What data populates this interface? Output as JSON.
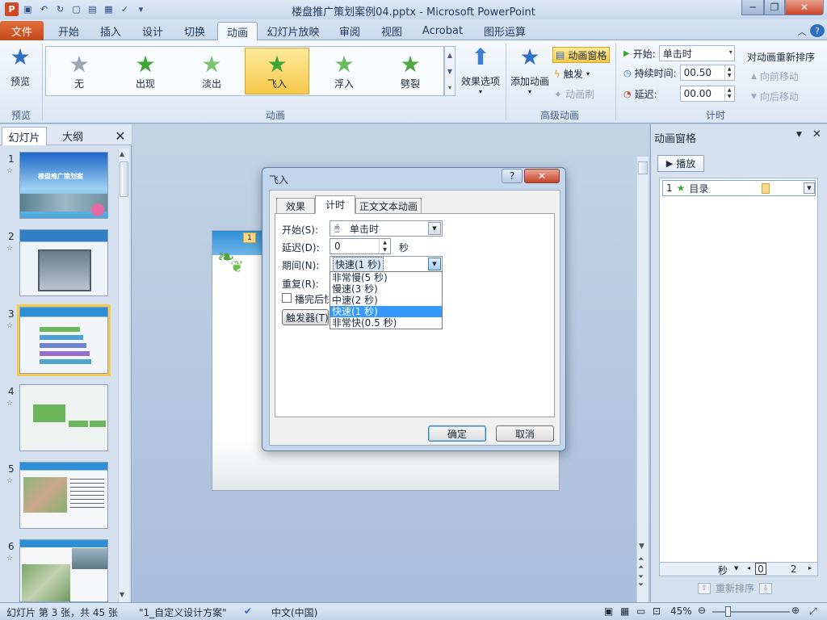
{
  "window": {
    "title": "楼盘推广策划案例04.pptx - Microsoft PowerPoint",
    "min": "─",
    "max": "❐",
    "close": "✕"
  },
  "tabs": [
    "开始",
    "插入",
    "设计",
    "切换",
    "动画",
    "幻灯片放映",
    "审阅",
    "视图",
    "Acrobat",
    "图形运算"
  ],
  "file_tab": "文件",
  "active_tab": "动画",
  "ribbon": {
    "preview": {
      "label": "预览",
      "group": "预览"
    },
    "gallery": {
      "items": [
        "无",
        "出现",
        "淡出",
        "飞入",
        "浮入",
        "劈裂"
      ],
      "selected": "飞入",
      "group": "动画"
    },
    "effect_options": "效果选项",
    "add_animation": "添加动画",
    "anim_pane": "动画窗格",
    "trigger": "触发",
    "anim_painter": "动画刷",
    "advanced_group": "高级动画",
    "start_label": "开始:",
    "start_value": "单击时",
    "duration_label": "持续时间:",
    "duration_value": "00.50",
    "delay_label": "延迟:",
    "delay_value": "00.00",
    "timing_group": "计时",
    "reorder_title": "对动画重新排序",
    "move_earlier": "向前移动",
    "move_later": "向后移动"
  },
  "left_pane": {
    "tab_slides": "幻灯片",
    "tab_outline": "大纲",
    "close": "✕",
    "slides": [
      {
        "num": "1",
        "caption": "楼盘推广策划案"
      },
      {
        "num": "2",
        "caption": ""
      },
      {
        "num": "3",
        "caption": ""
      },
      {
        "num": "4",
        "caption": ""
      },
      {
        "num": "5",
        "caption": ""
      },
      {
        "num": "6",
        "caption": ""
      }
    ],
    "current": "3"
  },
  "slide": {
    "tag": "1"
  },
  "anim_pane": {
    "title": "动画窗格",
    "play": "播放",
    "item_num": "1",
    "item_name": "目录",
    "seconds": "秒",
    "tick0": "0",
    "tick2": "2",
    "reorder": "重新排序"
  },
  "dialog": {
    "title": "飞入",
    "help": "?",
    "close": "✕",
    "tabs": [
      "效果",
      "计时",
      "正文文本动画"
    ],
    "active_tab": "计时",
    "start_label": "开始(S):",
    "start_value": "单击时",
    "delay_label": "延迟(D):",
    "delay_value": "0",
    "delay_unit": "秒",
    "period_label": "期间(N):",
    "period_value": "快速(1 秒)",
    "repeat_label": "重复(R):",
    "rewind_label": "播完后快退(W)",
    "trigger_btn": "触发器(T)",
    "options": [
      "非常慢(5 秒)",
      "慢速(3 秒)",
      "中速(2 秒)",
      "快速(1 秒)",
      "非常快(0.5 秒)"
    ],
    "highlighted_option": "快速(1 秒)",
    "ok": "确定",
    "cancel": "取消"
  },
  "statusbar": {
    "slide_info": "幻灯片 第 3 张，共 45 张",
    "theme": "\"1_自定义设计方案\"",
    "language": "中文(中国)",
    "zoom": "45%"
  },
  "colors": {
    "accent_orange": "#c5491b",
    "selection_blue": "#3399ff",
    "star_green": "#3fa535"
  }
}
